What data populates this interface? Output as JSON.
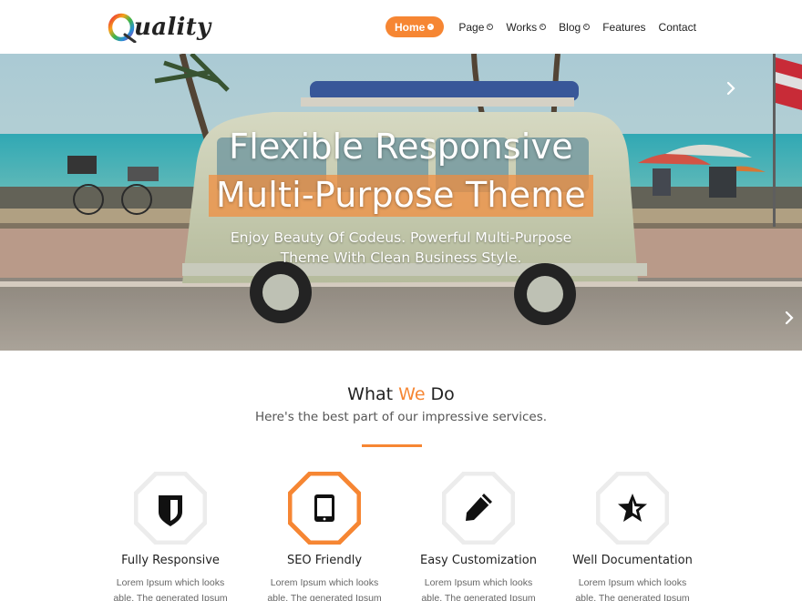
{
  "brand": {
    "logo_letter": "Q",
    "logo_word": "uality"
  },
  "nav": {
    "items": [
      {
        "label": "Home",
        "active": true,
        "dropdown": true
      },
      {
        "label": "Page",
        "active": false,
        "dropdown": true
      },
      {
        "label": "Works",
        "active": false,
        "dropdown": true
      },
      {
        "label": "Blog",
        "active": false,
        "dropdown": true
      },
      {
        "label": "Features",
        "active": false,
        "dropdown": false
      },
      {
        "label": "Contact",
        "active": false,
        "dropdown": false
      }
    ]
  },
  "hero": {
    "title_line1": "Flexible Responsive",
    "title_line2": "Multi-Purpose Theme",
    "subtitle_line1": "Enjoy Beauty Of Codeus. Powerful Multi-Purpose",
    "subtitle_line2": "Theme With Clean Business Style."
  },
  "services": {
    "title_pre": "What ",
    "title_accent": "We",
    "title_post": " Do",
    "subtitle": "Here's the best part of our impressive services.",
    "items": [
      {
        "title": "Fully Responsive",
        "icon": "shield-icon",
        "highlighted": false,
        "text_line1": "Lorem Ipsum which looks",
        "text_line2": "able. The generated Ipsum"
      },
      {
        "title": "SEO Friendly",
        "icon": "tablet-icon",
        "highlighted": true,
        "text_line1": "Lorem Ipsum which looks",
        "text_line2": "able. The generated Ipsum"
      },
      {
        "title": "Easy Customization",
        "icon": "pencil-icon",
        "highlighted": false,
        "text_line1": "Lorem Ipsum which looks",
        "text_line2": "able. The generated Ipsum"
      },
      {
        "title": "Well Documentation",
        "icon": "star-icon",
        "highlighted": false,
        "text_line1": "Lorem Ipsum which looks",
        "text_line2": "able. The generated Ipsum"
      }
    ]
  },
  "colors": {
    "accent": "#f68633",
    "text_dark": "#222222",
    "text_muted": "#666666"
  }
}
